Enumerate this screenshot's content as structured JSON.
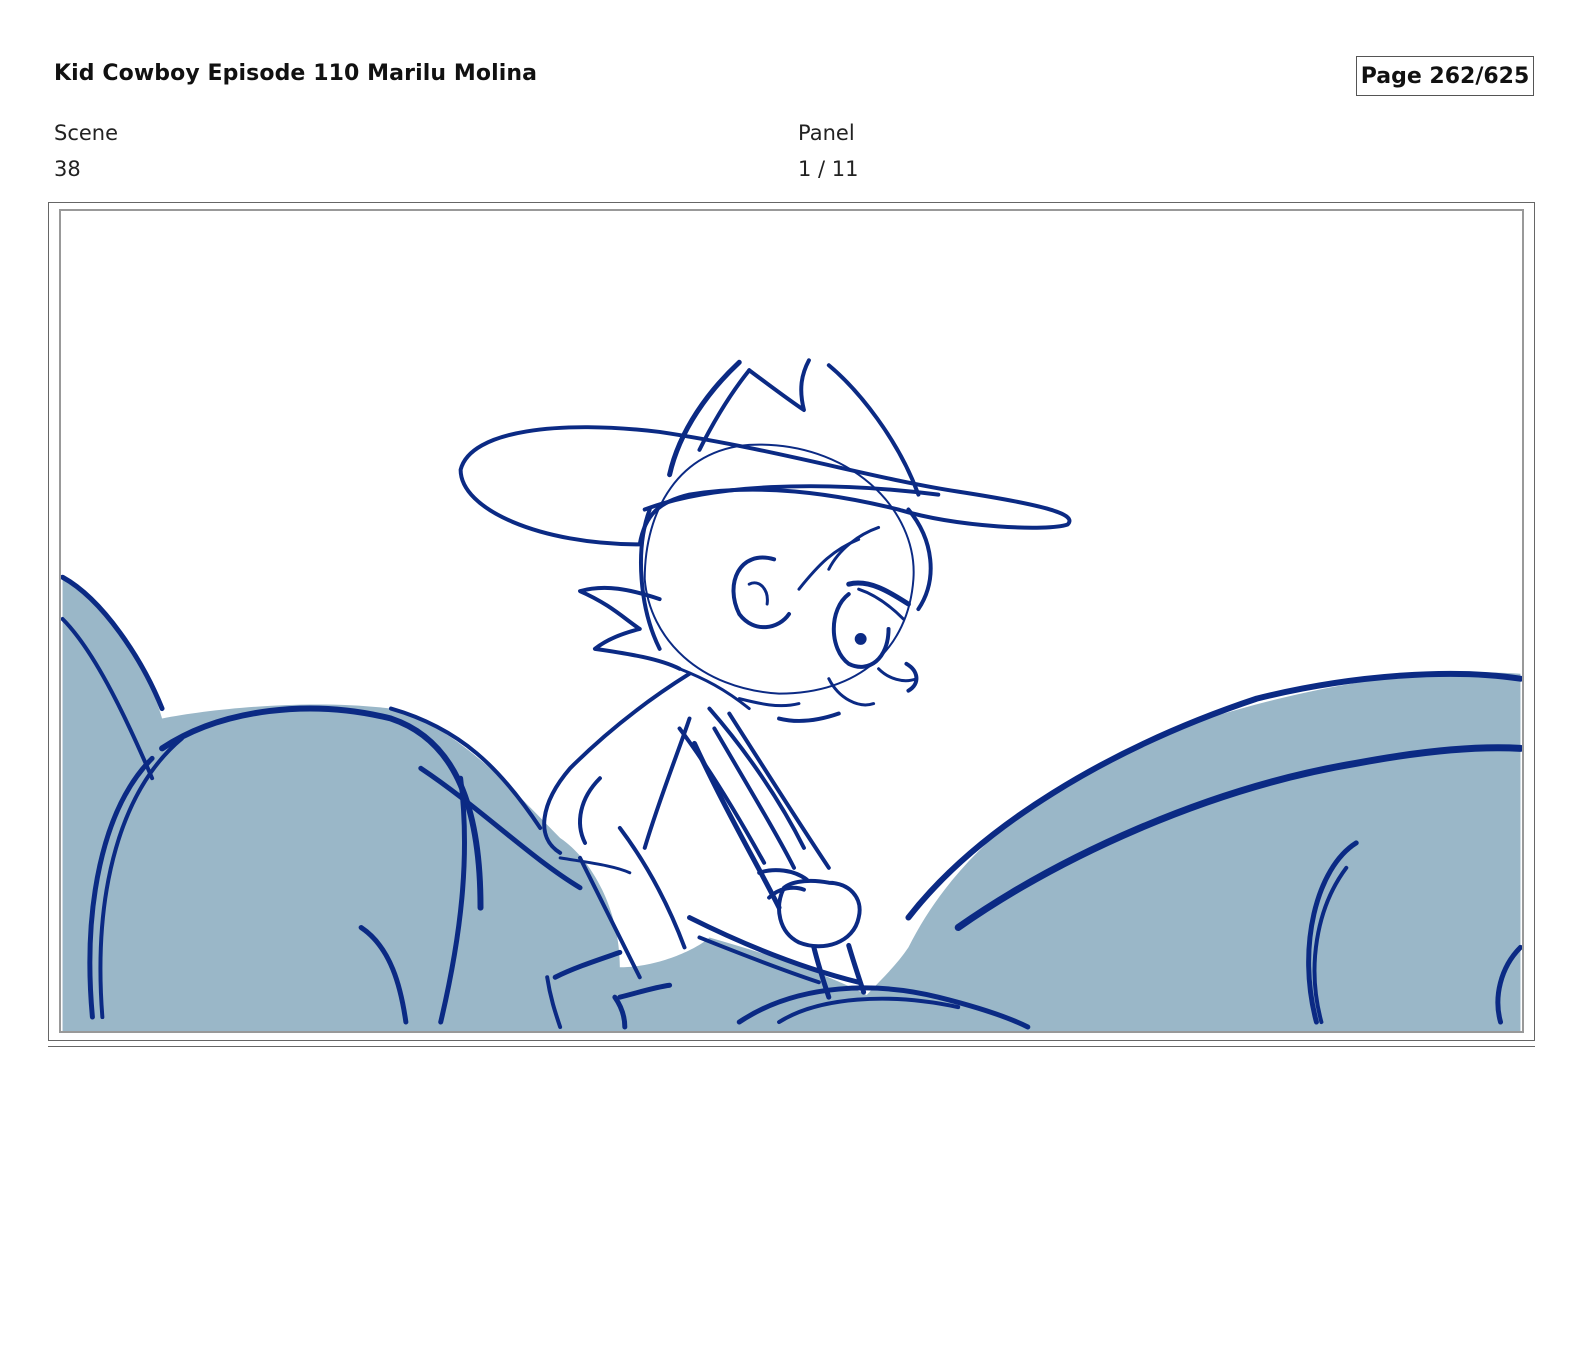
{
  "header": {
    "title": "Kid Cowboy Episode 110 Marilu Molina",
    "page": "Page 262/625"
  },
  "meta": {
    "scene_label": "Scene",
    "scene_value": "38",
    "panel_label": "Panel",
    "panel_value": "1 / 11"
  },
  "artwork": {
    "colors": {
      "ink": "#0b2a84",
      "fill": "#9ab7c8",
      "background": "#ffffff"
    }
  }
}
